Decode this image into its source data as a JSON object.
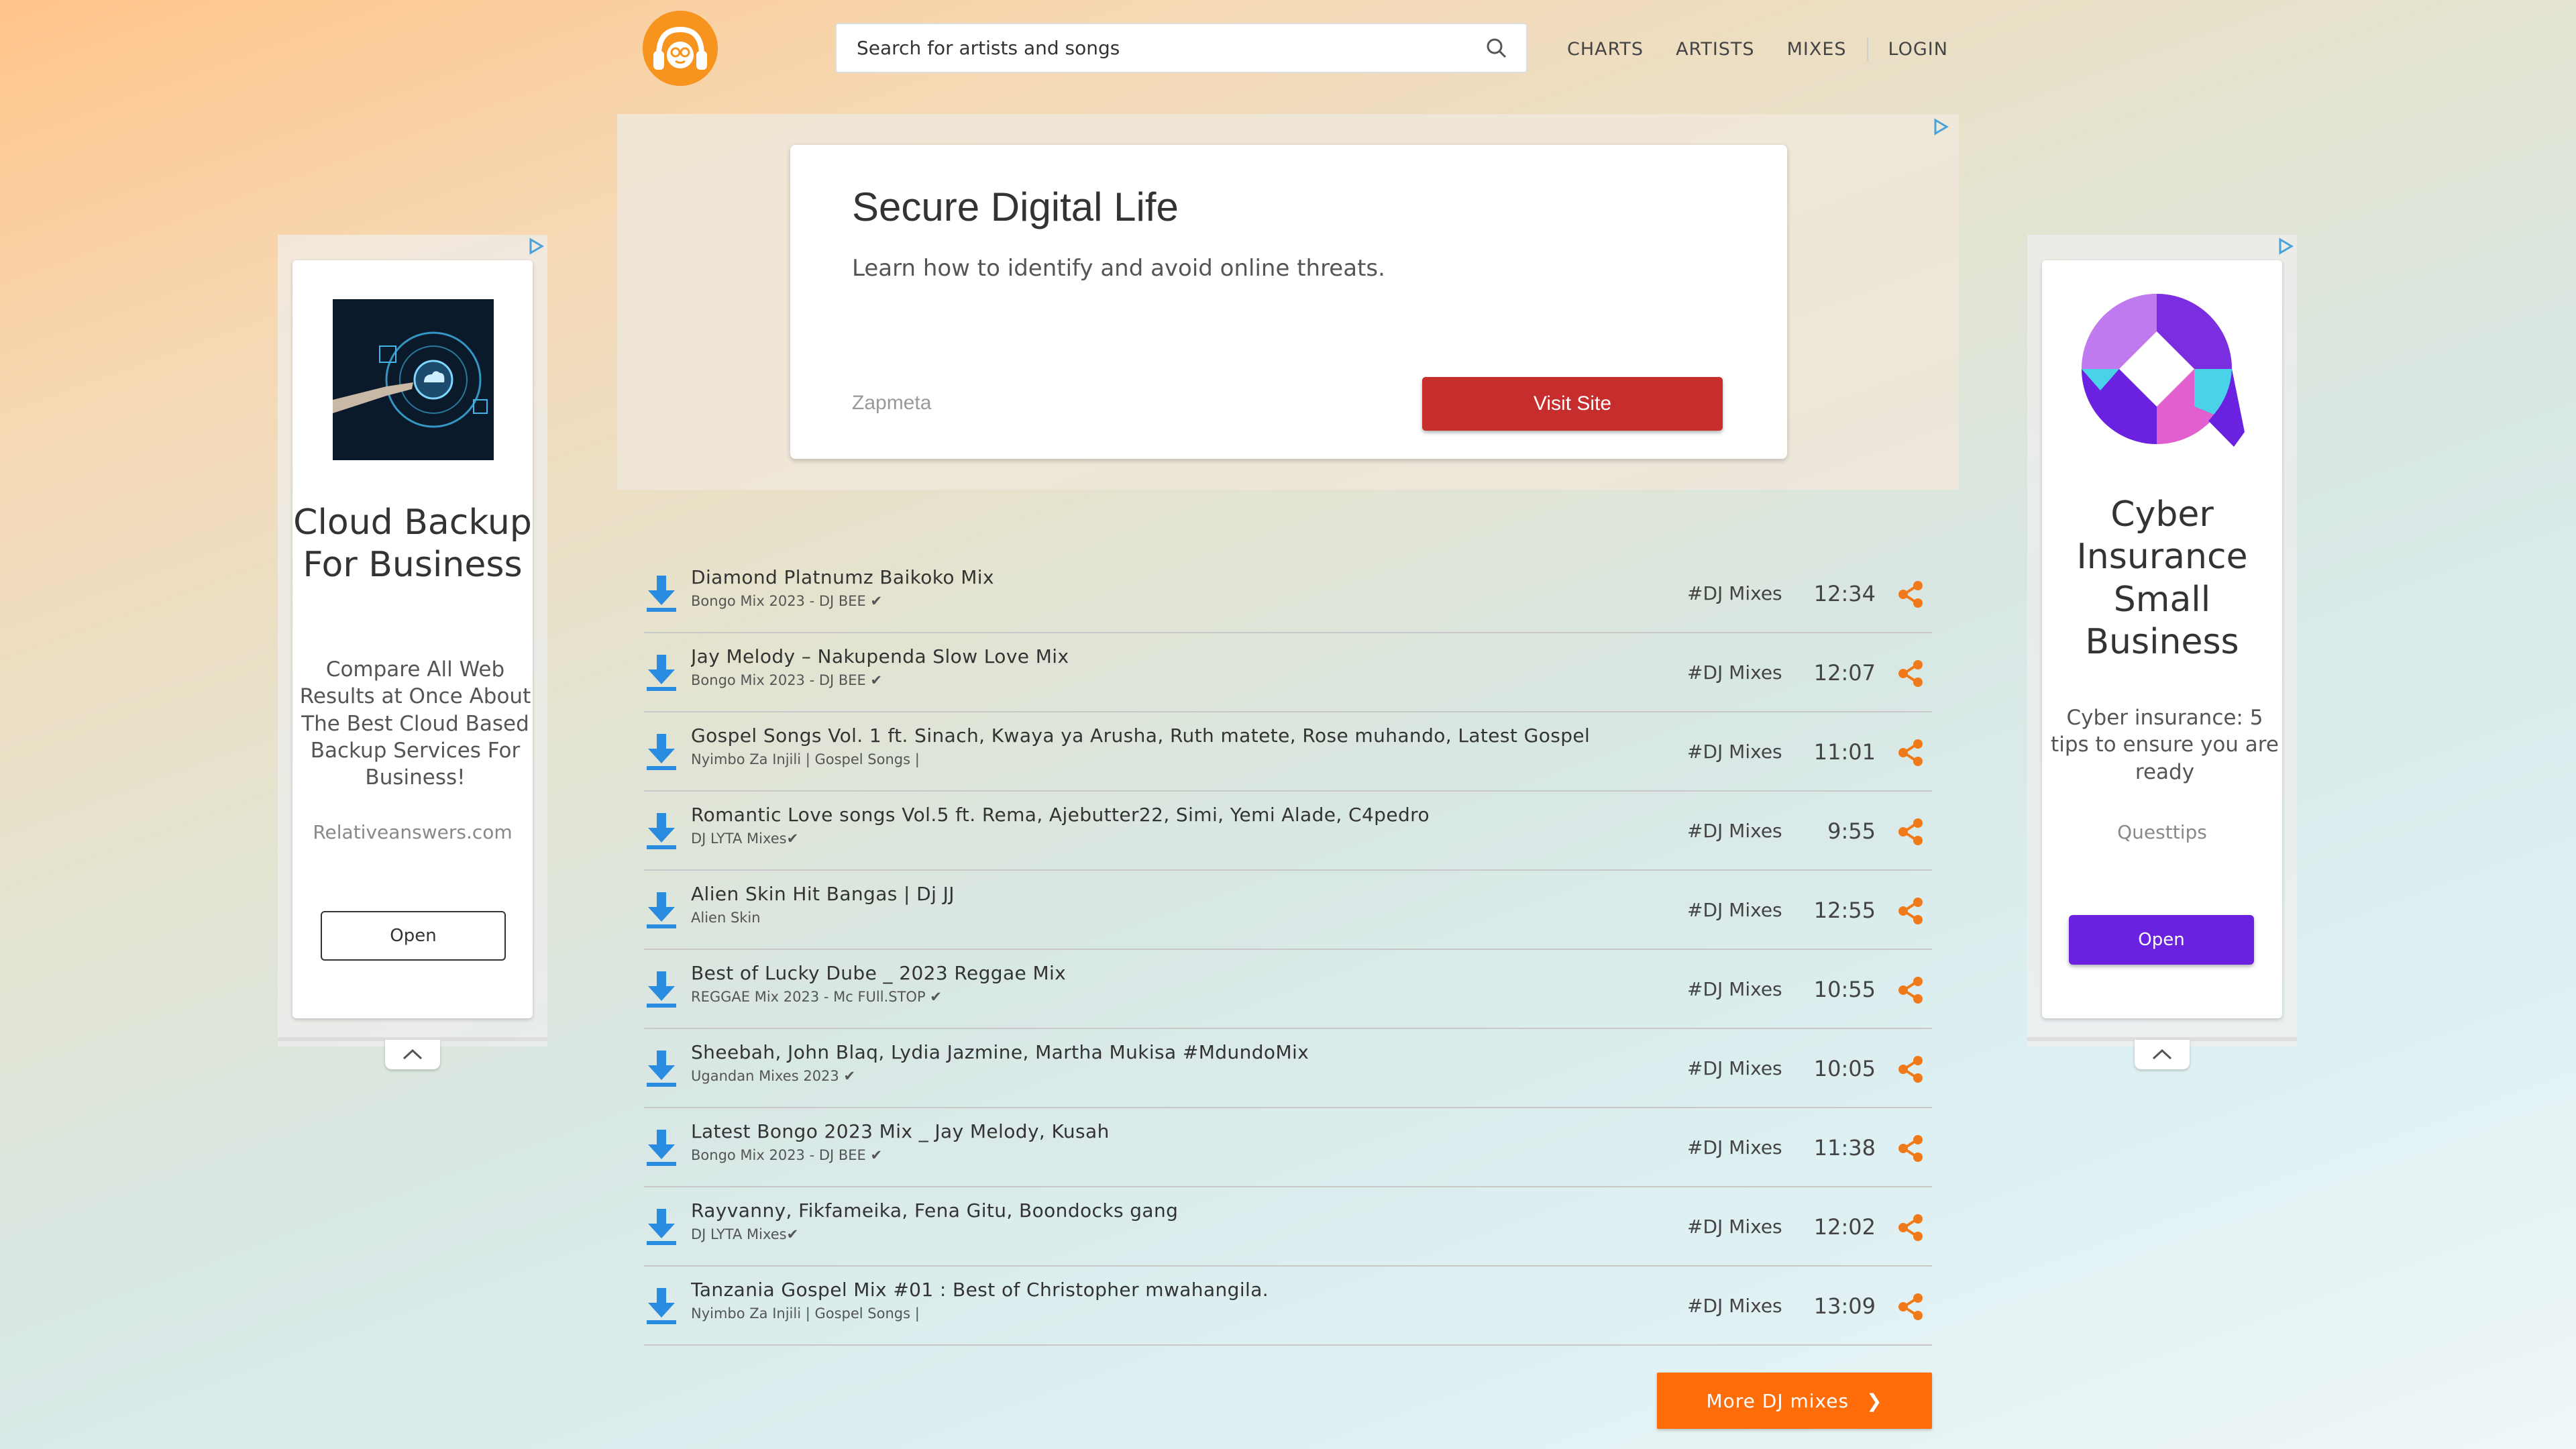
{
  "header": {
    "search_placeholder": "Search for artists and songs",
    "nav": [
      "CHARTS",
      "ARTISTS",
      "MIXES",
      "LOGIN"
    ]
  },
  "top_ad": {
    "title": "Secure Digital Life",
    "description": "Learn how to identify and avoid online threats.",
    "source": "Zapmeta",
    "button": "Visit Site"
  },
  "left_ad": {
    "title": "Cloud Backup For Business",
    "description": "Compare All Web Results at Once About The Best Cloud Based Backup Services For Business!",
    "source": "Relativeanswers.com",
    "button": "Open"
  },
  "right_ad": {
    "title": "Cyber Insurance Small Business",
    "description": "Cyber insurance: 5 tips to ensure you are ready",
    "source": "Questtips",
    "button": "Open"
  },
  "mixes": [
    {
      "title": "Diamond Platnumz Baikoko Mix",
      "subtitle": "Bongo Mix 2023 - DJ BEE ✔",
      "tag": "#DJ Mixes",
      "duration": "12:34"
    },
    {
      "title": "Jay Melody – Nakupenda Slow Love Mix",
      "subtitle": "Bongo Mix 2023 - DJ BEE ✔",
      "tag": "#DJ Mixes",
      "duration": "12:07"
    },
    {
      "title": "Gospel Songs Vol. 1 ft. Sinach, Kwaya ya Arusha, Ruth matete, Rose muhando, Latest Gospel...",
      "subtitle": "Nyimbo Za Injili | Gospel Songs |",
      "tag": "#DJ Mixes",
      "duration": "11:01"
    },
    {
      "title": "Romantic Love songs Vol.5 ft. Rema, Ajebutter22, Simi, Yemi Alade, C4pedro",
      "subtitle": "DJ LYTA Mixes✔",
      "tag": "#DJ Mixes",
      "duration": "9:55"
    },
    {
      "title": "Alien Skin Hit Bangas | Dj JJ",
      "subtitle": "Alien Skin",
      "tag": "#DJ Mixes",
      "duration": "12:55"
    },
    {
      "title": "Best of Lucky Dube _ 2023 Reggae Mix",
      "subtitle": "REGGAE Mix 2023 - Mc FUll.STOP ✔",
      "tag": "#DJ Mixes",
      "duration": "10:55"
    },
    {
      "title": "Sheebah, John Blaq, Lydia Jazmine, Martha Mukisa #MdundoMix",
      "subtitle": "Ugandan Mixes 2023 ✔",
      "tag": "#DJ Mixes",
      "duration": "10:05"
    },
    {
      "title": "Latest Bongo 2023 Mix _ Jay Melody, Kusah",
      "subtitle": "Bongo Mix 2023 - DJ BEE ✔",
      "tag": "#DJ Mixes",
      "duration": "11:38"
    },
    {
      "title": "Rayvanny, Fikfameika, Fena Gitu, Boondocks gang",
      "subtitle": "DJ LYTA Mixes✔",
      "tag": "#DJ Mixes",
      "duration": "12:02"
    },
    {
      "title": "Tanzania Gospel Mix #01 : Best of Christopher mwahangila.",
      "subtitle": "Nyimbo Za Injili | Gospel Songs |",
      "tag": "#DJ Mixes",
      "duration": "13:09"
    }
  ],
  "more_button": "More DJ mixes",
  "colors": {
    "accent": "#ff6d0a",
    "download_icon": "#2a8ce0",
    "share_icon": "#f07a1a",
    "visit_button": "#c62d2d",
    "open_button_purple": "#6a22e0"
  }
}
